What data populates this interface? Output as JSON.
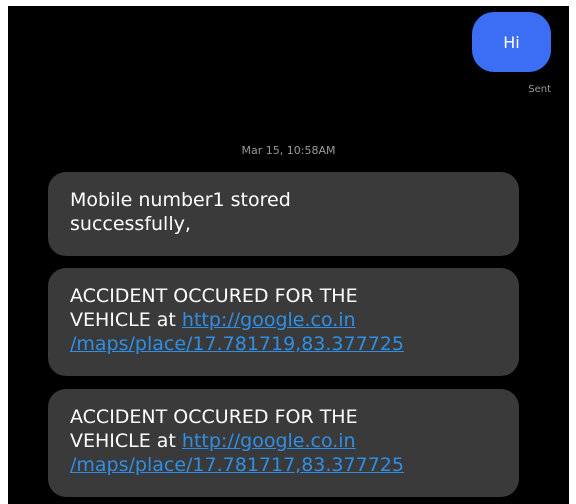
{
  "conversation": {
    "outgoing": [
      {
        "text": "Hi",
        "status": "Sent"
      }
    ],
    "date_separator": "Mar 15, 10:58AM",
    "incoming": [
      {
        "line1": "Mobile number1 stored",
        "line2": "successfully,"
      },
      {
        "line1": "ACCIDENT OCCURED FOR THE",
        "line2_prefix": "VEHICLE  at ",
        "link_part1": "http://google.co.in",
        "link_part2": "/maps/place/17.781719,83.377725"
      },
      {
        "line1": "ACCIDENT OCCURED FOR THE",
        "line2_prefix": "VEHICLE  at ",
        "link_part1": "http://google.co.in",
        "link_part2": "/maps/place/17.781717,83.377725"
      }
    ]
  },
  "colors": {
    "background": "#000000",
    "sent_bubble": "#3b6ef5",
    "received_bubble": "#3a3a3a",
    "link": "#2f8fe6",
    "muted_text": "#9a9a9a"
  }
}
